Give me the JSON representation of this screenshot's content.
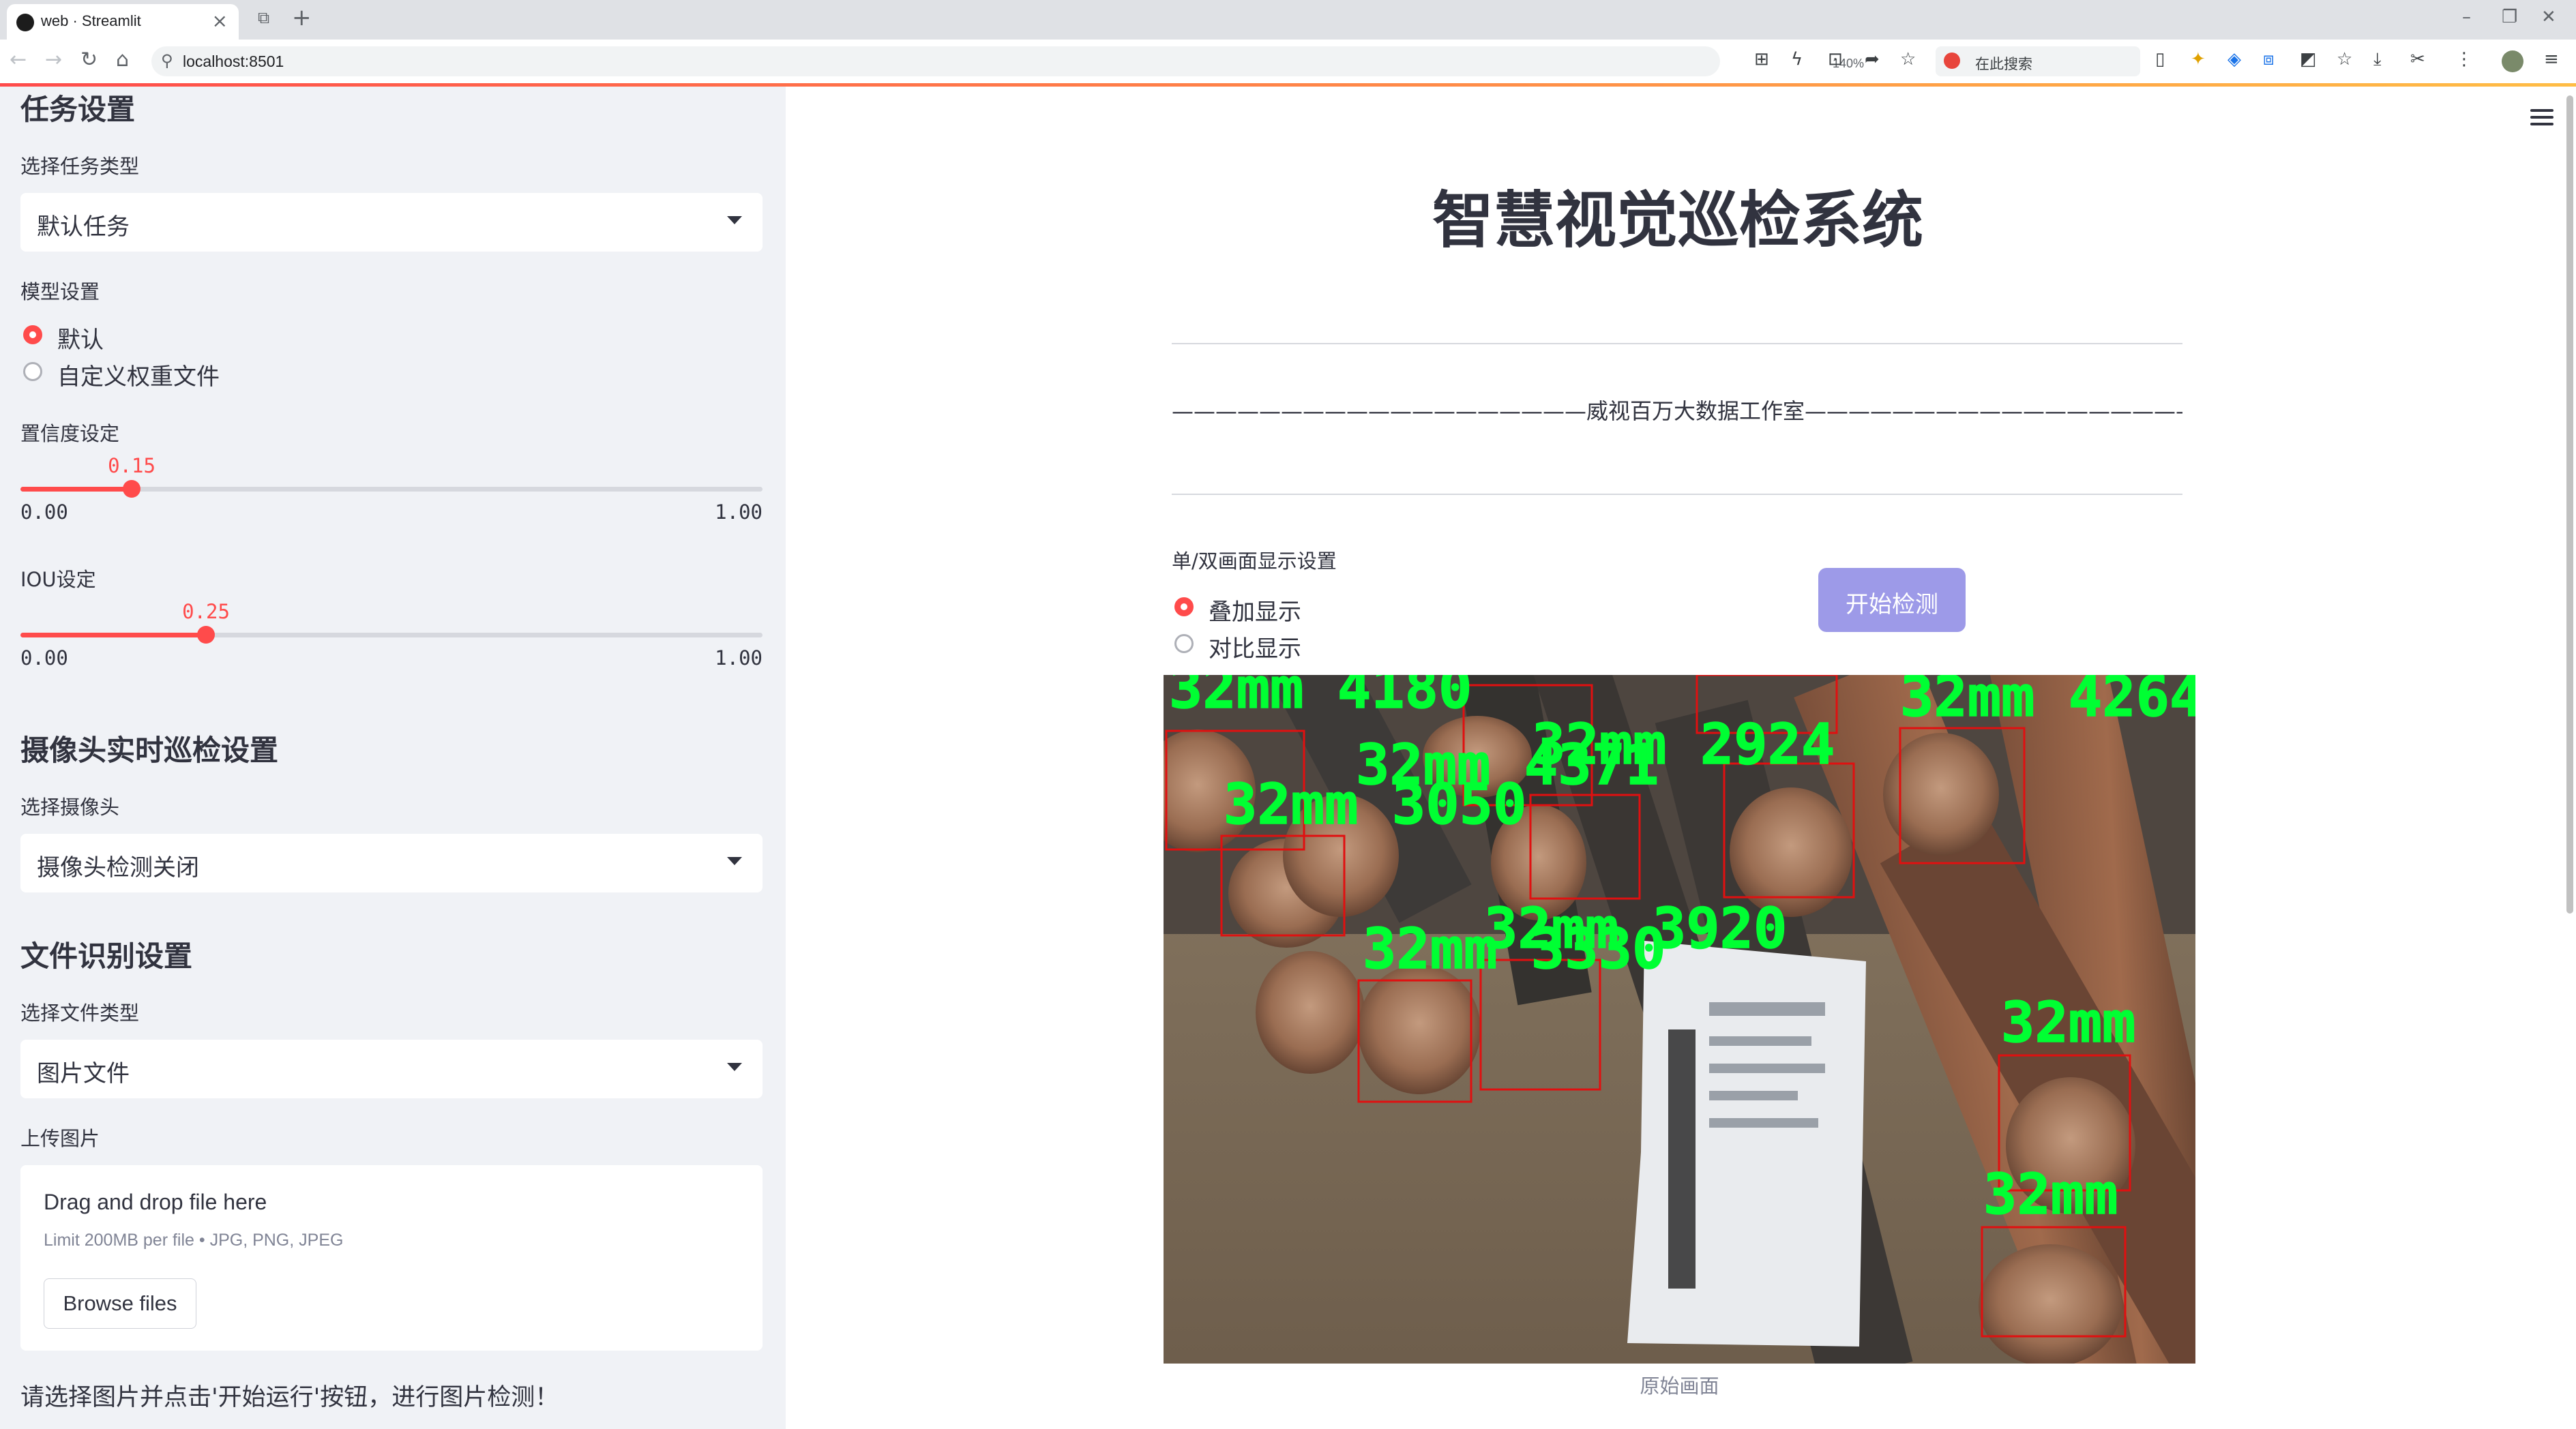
{
  "browser": {
    "tab_title": "web · Streamlit",
    "url": "localhost:8501",
    "zoom": "140%",
    "search_placeholder": "在此搜索"
  },
  "sidebar": {
    "task_heading": "任务设置",
    "task_type_label": "选择任务类型",
    "task_type_value": "默认任务",
    "model_label": "模型设置",
    "model_options": [
      "默认",
      "自定义权重文件"
    ],
    "model_selected": "默认",
    "conf_label": "置信度设定",
    "conf": {
      "value": 0.15,
      "value_text": "0.15",
      "min": "0.00",
      "max": "1.00"
    },
    "iou_label": "IOU设定",
    "iou": {
      "value": 0.25,
      "value_text": "0.25",
      "min": "0.00",
      "max": "1.00"
    },
    "camera_heading": "摄像头实时巡检设置",
    "camera_label": "选择摄像头",
    "camera_value": "摄像头检测关闭",
    "file_heading": "文件识别设置",
    "file_type_label": "选择文件类型",
    "file_type_value": "图片文件",
    "upload_label": "上传图片",
    "upload": {
      "drag_text": "Drag and drop file here",
      "limit_text": "Limit 200MB per file • JPG, PNG, JPEG",
      "browse_label": "Browse files"
    },
    "hint": "请选择图片并点击'开始运行'按钮，进行图片检测！"
  },
  "main": {
    "title": "智慧视觉巡检系统",
    "studio_line": "———————————————————威视百万大数据工作室————————————————————",
    "display_label": "单/双画面显示设置",
    "display_options": [
      "叠加显示",
      "对比显示"
    ],
    "display_selected": "叠加显示",
    "start_button": "开始检测",
    "image_caption": "原始画面",
    "detections": [
      {
        "text": "32mm 4180"
      },
      {
        "text": "32mm 4371"
      },
      {
        "text": "32mm 4264"
      },
      {
        "text": "32mm 3050"
      },
      {
        "text": "32mm 2924"
      },
      {
        "text": "32mm 3330"
      },
      {
        "text": "32mm 3920"
      },
      {
        "text": "32mm"
      },
      {
        "text": "32mm"
      }
    ],
    "detection_color": "#00ff33",
    "box_color": "#e01010"
  },
  "colors": {
    "accent": "#ff4b4b",
    "sidebar_bg": "#f0f2f6",
    "button_disabled": "#9d9ae8"
  }
}
